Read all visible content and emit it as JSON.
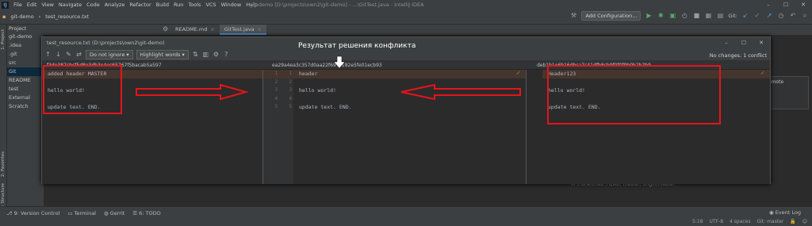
{
  "menubar": {
    "items": [
      "File",
      "Edit",
      "View",
      "Navigate",
      "Code",
      "Analyze",
      "Refactor",
      "Build",
      "Run",
      "Tools",
      "VCS",
      "Window",
      "Help"
    ],
    "window_title": "git-demo [D:\\projects\\own2\\git-demo] - ...\\GitTest.java - IntelliJ IDEA"
  },
  "navbar": {
    "project": "git-demo",
    "file": "test_resource.txt",
    "add_config": "Add Configuration...",
    "git_label": "Git:"
  },
  "side_tabs": {
    "project": "1: Project",
    "favorites": "2: Favorites",
    "structure": "Z: Structure"
  },
  "project_panel": {
    "title": "Project",
    "tree": [
      "git-demo",
      ".idea",
      ".git",
      "src",
      "Git",
      "README",
      "test",
      "External",
      "Scratch"
    ]
  },
  "editor_tabs": [
    {
      "label": "README.md"
    },
    {
      "label": "GitTest.java"
    }
  ],
  "merge_dialog": {
    "title": "test_resource.txt (D:\\projects\\own2\\git-demo)",
    "ignore_option": "Do not ignore",
    "highlight_option": "Highlight words",
    "status": "No changes. 1 conflict",
    "headers": {
      "left": "f3de387cbcf5d8e3db3e4ec65767f5bacab5a597",
      "center": "ea29a4ea3c357d0aa22f697c182e5fe01ecb93",
      "right": "deb1b1e6b16dbca7c41dfb8cb9f0f0f9b0b2b2b9"
    },
    "left_lines": [
      "added header MASTER",
      "",
      "hello world!",
      "",
      "update text. END."
    ],
    "center_lines": [
      "header",
      "",
      "hello world!",
      "",
      "update text. END."
    ],
    "right_lines": [
      "Header123",
      "",
      "hello world!",
      "",
      "update text. END."
    ],
    "line_numbers": [
      "1",
      "2",
      "3",
      "4",
      "5"
    ]
  },
  "annotation": {
    "title": "Результат решения конфликта"
  },
  "background": {
    "popup_label": "Remote",
    "branch_text": "in 3 branches: HEAD, master, origin/master"
  },
  "statusbar": {
    "tabs": [
      "9: Version Control",
      "Terminal",
      "Gerrit",
      "6: TODO"
    ],
    "event_log": "Event Log",
    "position": "5:18",
    "encoding": "UTF-8",
    "indent": "4 spaces",
    "branch": "Git: master"
  },
  "colors": {
    "annotation_red": "#e5141b",
    "conflict_bg": "#45352d",
    "accent_blue": "#4a88c7"
  }
}
